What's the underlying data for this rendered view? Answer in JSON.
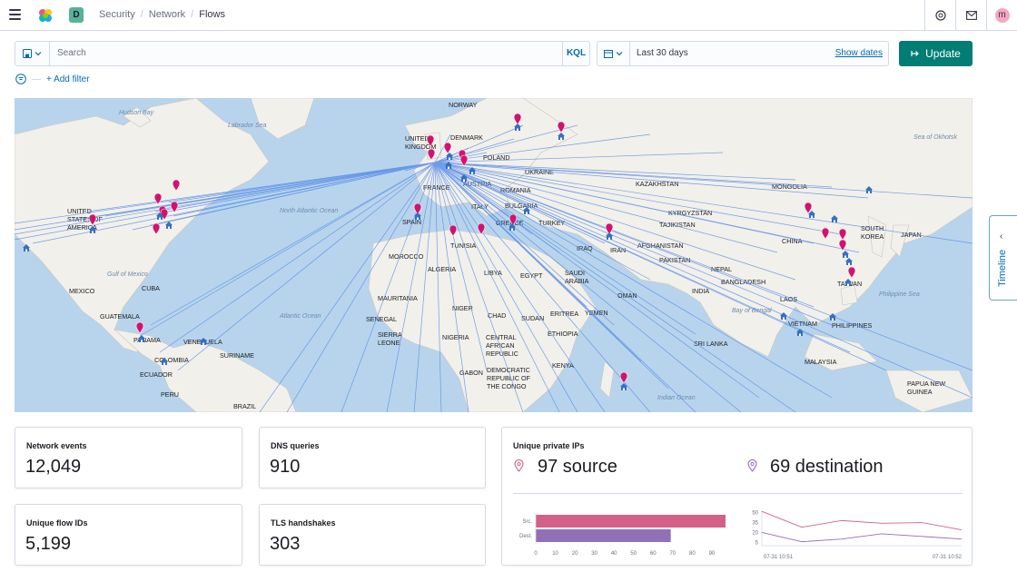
{
  "header": {
    "space_initial": "D",
    "breadcrumbs": [
      "Security",
      "Network",
      "Flows"
    ],
    "avatar_initial": "m"
  },
  "query": {
    "search_placeholder": "Search",
    "language": "KQL",
    "date_range": "Last 30 days",
    "show_dates_label": "Show dates",
    "update_label": "Update",
    "add_filter_label": "+ Add filter"
  },
  "timeline_tab": {
    "label": "Timeline"
  },
  "map": {
    "water_color": "#b8d4ec",
    "land_color": "#f2f0ea",
    "flow_line_color": "#5a8fe8",
    "marker_color": "#d1136f",
    "labels": [
      "NORWAY",
      "DENMARK",
      "UNITED KINGDOM",
      "POLAND",
      "UKRAINE",
      "FRANCE",
      "AUSTRIA",
      "ROMANIA",
      "KAZAKHSTAN",
      "MONGOLIA",
      "KYRGYZSTAN",
      "TAJIKISTAN",
      "ITALY",
      "BULGARIA",
      "SPAIN",
      "GREECE",
      "TURKEY",
      "CHINA",
      "SOUTH KOREA",
      "JAPAN",
      "UNITED STATES OF AMERICA",
      "TUNISIA",
      "IRAN",
      "AFGHANISTAN",
      "IRAQ",
      "PAKISTAN",
      "MOROCCO",
      "ALGERIA",
      "LIBYA",
      "EGYPT",
      "SAUDI ARABIA",
      "NEPAL",
      "INDIA",
      "BANGLADESH",
      "TAIWAN",
      "MEXICO",
      "CUBA",
      "OMAN",
      "LAOS",
      "MAURITANIA",
      "YEMEN",
      "GUATEMALA",
      "SENEGAL",
      "NIGER",
      "CHAD",
      "SUDAN",
      "ERITREA",
      "VIETNAM",
      "PHILIPPINES",
      "SIERRA LEONE",
      "NIGERIA",
      "CENTRAL AFRICAN REPUBLIC",
      "ETHIOPIA",
      "SRI LANKA",
      "PANAMA",
      "VENEZUELA",
      "SURINAME",
      "COLOMBIA",
      "GABON",
      "DEMOCRATIC REPUBLIC OF THE CONGO",
      "KENYA",
      "ECUADOR",
      "MALAYSIA",
      "PERU",
      "PAPUA NEW GUINEA",
      "BRAZIL"
    ],
    "water_labels": [
      "Hudson Bay",
      "Labrador Sea",
      "North Atlantic Ocean",
      "Gulf of Mexico",
      "Atlantic Ocean",
      "Bay of Bengal",
      "Indian Ocean",
      "Philippine Sea",
      "Sea of Okhotsk"
    ]
  },
  "kpis": {
    "network_events": {
      "title": "Network events",
      "value": "12,049"
    },
    "dns_queries": {
      "title": "DNS queries",
      "value": "910"
    },
    "unique_flow_ids": {
      "title": "Unique flow IDs",
      "value": "5,199"
    },
    "tls_handshakes": {
      "title": "TLS handshakes",
      "value": "303"
    }
  },
  "unique_private_ips": {
    "title": "Unique private IPs",
    "source_value": "97 source",
    "destination_value": "69 destination",
    "source_color": "#d36086",
    "destination_color": "#9170b8"
  },
  "chart_data": [
    {
      "type": "bar",
      "orientation": "horizontal",
      "categories": [
        "Src.",
        "Dest."
      ],
      "values": [
        97,
        69
      ],
      "xticks": [
        0,
        10,
        20,
        30,
        40,
        50,
        60,
        70,
        80,
        90
      ],
      "xlim": [
        0,
        97
      ]
    },
    {
      "type": "line",
      "x": [
        "07-31 10:51",
        "",
        "",
        "",
        "",
        "07-31 10:52"
      ],
      "series": [
        {
          "values": [
            52,
            28,
            38,
            34,
            35,
            24
          ]
        },
        {
          "values": [
            20,
            6,
            10,
            18,
            14,
            10
          ]
        }
      ],
      "yticks": [
        50,
        35,
        20,
        5
      ],
      "xtick_labels": [
        "07-31 10:51",
        "07-31 10:52"
      ],
      "ylim": [
        0,
        55
      ]
    }
  ]
}
